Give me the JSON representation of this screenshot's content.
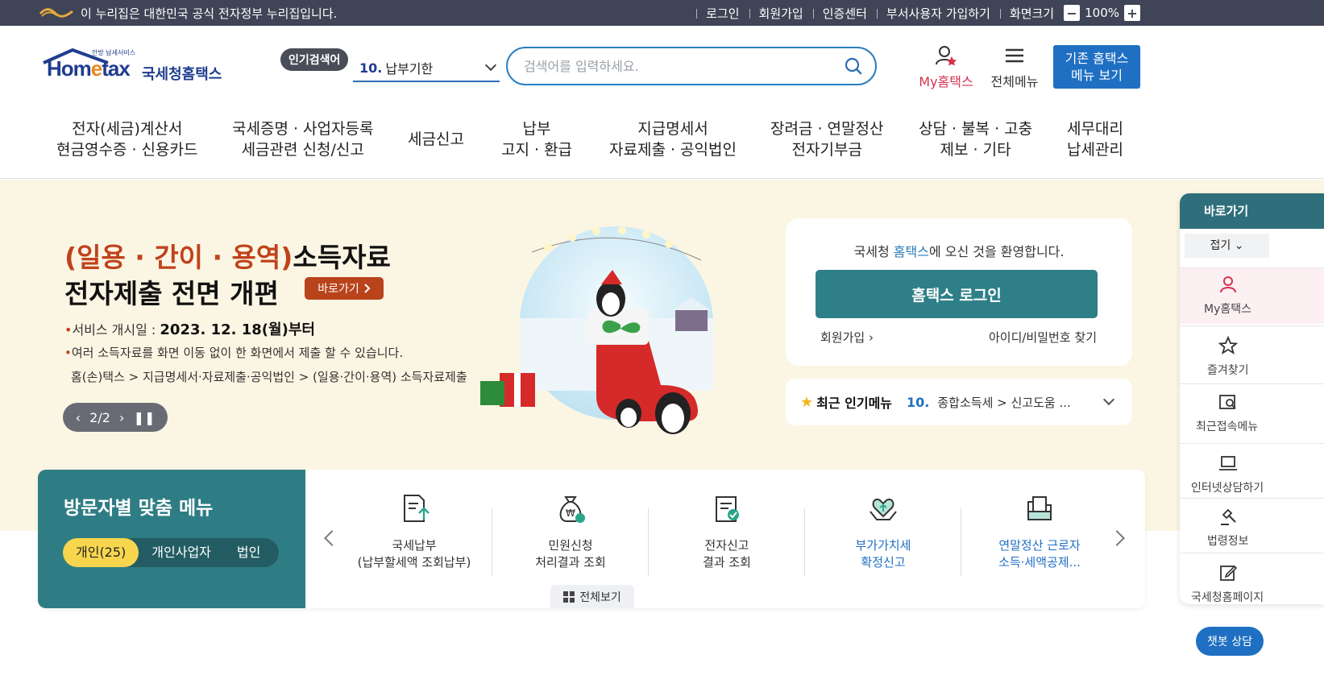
{
  "gov_bar": {
    "notice": "이 누리집은 대한민국 공식 전자정부 누리집입니다.",
    "links": [
      "로그인",
      "회원가입",
      "인증센터",
      "부서사용자 가입하기",
      "화면크기"
    ],
    "zoom_value": "100%",
    "zoom_minus": "−",
    "zoom_plus": "+"
  },
  "header": {
    "logo_sub": "안방 납세서비스",
    "logo_home": "Hom",
    "logo_e": "e",
    "logo_tax": "tax",
    "logo_kr": "국세청홈택스",
    "popular_badge": "인기검색어",
    "popular_num": "10.",
    "popular_term": "납부기한",
    "search_placeholder": "검색어를 입력하세요.",
    "my_hometax": "My홈택스",
    "all_menu": "전체메뉴",
    "legacy_line1": "기존 홈택스",
    "legacy_line2": "메뉴 보기"
  },
  "gnb": [
    {
      "l1": "전자(세금)계산서",
      "l2": "현금영수증 · 신용카드"
    },
    {
      "l1": "국세증명 · 사업자등록",
      "l2": "세금관련 신청/신고"
    },
    {
      "l1": "세금신고",
      "l2": ""
    },
    {
      "l1": "납부",
      "l2": "고지 · 환급"
    },
    {
      "l1": "지급명세서",
      "l2": "자료제출 · 공익법인"
    },
    {
      "l1": "장려금 · 연말정산",
      "l2": "전자기부금"
    },
    {
      "l1": "상담 · 불복 · 고충",
      "l2": "제보 · 기타"
    },
    {
      "l1": "세무대리",
      "l2": "납세관리"
    }
  ],
  "hero": {
    "title_accent": "(일용 · 간이 · 용역)",
    "title_rest": "소득자료",
    "title_line2": "전자제출 전면 개편",
    "goto": "바로가기",
    "bullet1_label": "서비스 개시일 : ",
    "bullet1_value": "2023. 12. 18(월)부터",
    "bullet2": "여러 소득자료를 화면 이동 없이 한 화면에서 제출 할 수 있습니다.",
    "path": "홈(손)택스 > 지급명세서·자료제출·공익법인 > (일용·간이·용역) 소득자료제출",
    "slide_counter": "2/2"
  },
  "login_card": {
    "welcome_pre": "국세청 ",
    "welcome_hl": "홈택스",
    "welcome_post": "에 오신 것을 환영합니다.",
    "login_btn": "홈택스 로그인",
    "join": "회원가입",
    "find": "아이디/비밀번호 찾기"
  },
  "popular_menu": {
    "title": "최근 인기메뉴",
    "num": "10.",
    "value": "종합소득세 > 신고도움 ..."
  },
  "visitor": {
    "title": "방문자별 맞춤 메뉴",
    "tabs": [
      "개인(25)",
      "개인사업자",
      "법인"
    ],
    "items": [
      {
        "l1": "국세납부",
        "l2": "(납부할세액 조회납부)"
      },
      {
        "l1": "민원신청",
        "l2": "처리결과 조회"
      },
      {
        "l1": "전자신고",
        "l2": "결과 조회"
      },
      {
        "l1": "부가가치세",
        "l2": "확정신고"
      },
      {
        "l1": "연말정산 근로자",
        "l2": "소득·세액공제..."
      }
    ],
    "view_all": "전체보기"
  },
  "quick": {
    "title": "바로가기",
    "fold": "접기",
    "items": [
      "My홈택스",
      "즐겨찾기",
      "최근접속메뉴",
      "인터넷상담하기",
      "법령정보",
      "국세청홈페이지"
    ]
  },
  "chatbot": "챗봇 상담",
  "colors": {
    "gov_bar": "#3f4456",
    "primary_blue": "#1f6fc3",
    "teal": "#2f7d84",
    "hero_bg": "#fbf6e3",
    "accent_red": "#c0421c"
  }
}
